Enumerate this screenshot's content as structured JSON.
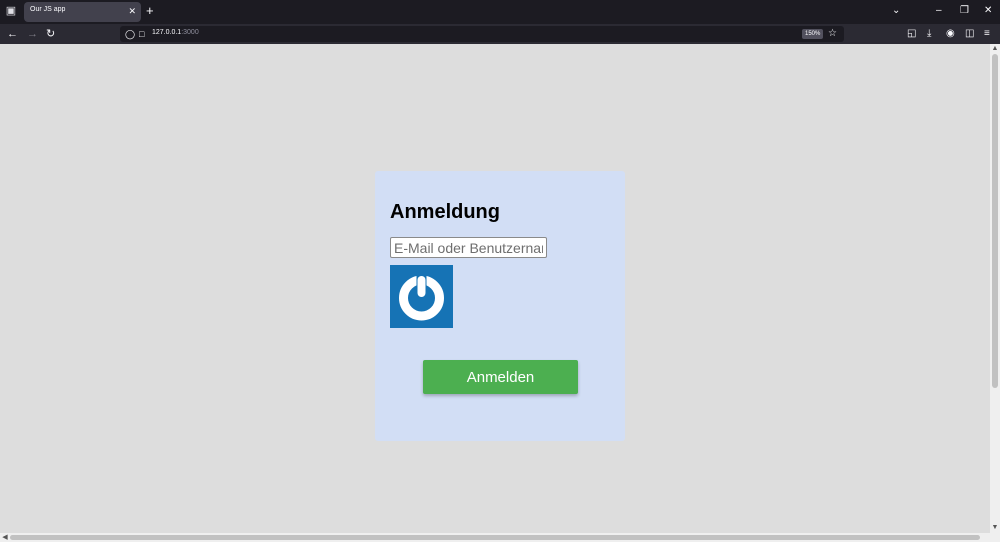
{
  "browser": {
    "tab_title": "Our JS app",
    "new_tab_label": "+",
    "url_host": "127.0.0.1",
    "url_port": ":3000",
    "zoom_level": "150%"
  },
  "login": {
    "title": "Anmeldung",
    "input_placeholder": "E-Mail oder Benutzername",
    "button_label": "Anmelden"
  },
  "colors": {
    "page_background": "#dddddd",
    "card_background": "#d2def5",
    "button_background": "#4caf50",
    "logo_background": "#1673b5"
  },
  "icons": {
    "app_logo": "power-icon"
  }
}
